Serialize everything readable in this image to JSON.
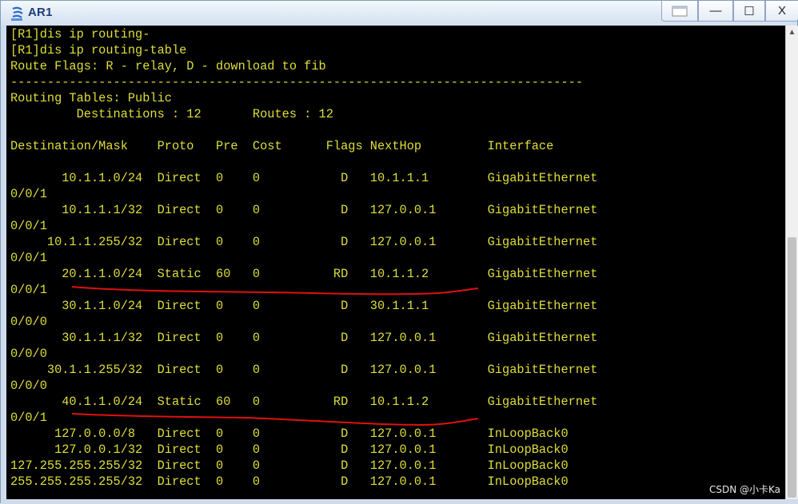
{
  "window": {
    "title": "AR1",
    "controls": {
      "extra": "",
      "minimize": "—",
      "maximize": "☐",
      "close": "X"
    }
  },
  "console": {
    "lines": [
      "[R1]dis ip routing-",
      "[R1]dis ip routing-table",
      "Route Flags: R - relay, D - download to fib",
      "------------------------------------------------------------------------------",
      "Routing Tables: Public",
      "         Destinations : 12       Routes : 12",
      "",
      "Destination/Mask    Proto   Pre  Cost      Flags NextHop         Interface",
      "",
      "       10.1.1.0/24  Direct  0    0           D   10.1.1.1        GigabitEthernet",
      "0/0/1",
      "       10.1.1.1/32  Direct  0    0           D   127.0.0.1       GigabitEthernet",
      "0/0/1",
      "     10.1.1.255/32  Direct  0    0           D   127.0.0.1       GigabitEthernet",
      "0/0/1",
      "       20.1.1.0/24  Static  60   0          RD   10.1.1.2        GigabitEthernet",
      "0/0/1",
      "       30.1.1.0/24  Direct  0    0           D   30.1.1.1        GigabitEthernet",
      "0/0/0",
      "       30.1.1.1/32  Direct  0    0           D   127.0.0.1       GigabitEthernet",
      "0/0/0",
      "     30.1.1.255/32  Direct  0    0           D   127.0.0.1       GigabitEthernet",
      "0/0/0",
      "       40.1.1.0/24  Static  60   0          RD   10.1.1.2        GigabitEthernet",
      "0/0/1",
      "      127.0.0.0/8   Direct  0    0           D   127.0.0.1       InLoopBack0",
      "      127.0.0.1/32  Direct  0    0           D   127.0.0.1       InLoopBack0",
      "127.255.255.255/32  Direct  0    0           D   127.0.0.1       InLoopBack0",
      "255.255.255.255/32  Direct  0    0           D   127.0.0.1       InLoopBack0"
    ]
  },
  "watermark": "CSDN @小卡Ka",
  "colors": {
    "console_bg": "#000000",
    "console_text": "#dede3c",
    "annotation": "#e01010",
    "title_text": "#1b3d78"
  }
}
